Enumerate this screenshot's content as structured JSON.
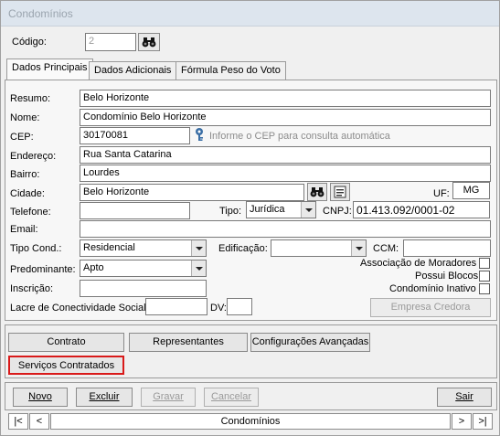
{
  "window": {
    "title": "Condomínios"
  },
  "header": {
    "codigo_label": "Código:",
    "codigo_value": "2"
  },
  "tabs": [
    {
      "label": "Dados Principais"
    },
    {
      "label": "Dados Adicionais"
    },
    {
      "label": "Fórmula Peso do Voto"
    }
  ],
  "form": {
    "resumo_label": "Resumo:",
    "resumo_value": "Belo Horizonte",
    "nome_label": "Nome:",
    "nome_value": "Condomínio Belo Horizonte",
    "cep_label": "CEP:",
    "cep_value": "30170081",
    "cep_hint": "Informe o CEP para consulta automática",
    "endereco_label": "Endereço:",
    "endereco_value": "Rua Santa Catarina",
    "bairro_label": "Bairro:",
    "bairro_value": "Lourdes",
    "cidade_label": "Cidade:",
    "cidade_value": "Belo Horizonte",
    "uf_label": "UF:",
    "uf_value": "MG",
    "telefone_label": "Telefone:",
    "telefone_value": "",
    "tipo_label": "Tipo:",
    "tipo_value": "Jurídica",
    "cnpj_label": "CNPJ:",
    "cnpj_value": "01.413.092/0001-02",
    "email_label": "Email:",
    "email_value": "",
    "tipo_cond_label": "Tipo Cond.:",
    "tipo_cond_value": "Residencial",
    "edificacao_label": "Edificação:",
    "edificacao_value": "",
    "ccm_label": "CCM:",
    "ccm_value": "",
    "predominante_label": "Predominante:",
    "predominante_value": "Apto",
    "inscricao_label": "Inscrição:",
    "inscricao_value": "",
    "lacre_label": "Lacre de Conectividade Social:",
    "lacre_value": "",
    "dv_label": "DV:",
    "dv_value": "",
    "assoc_label": "Associação de Moradores",
    "assoc_checked": false,
    "blocos_label": "Possui Blocos",
    "blocos_checked": false,
    "inativo_label": "Condomínio Inativo",
    "inativo_checked": false,
    "empresa_credora_label": "Empresa Credora"
  },
  "section_buttons": {
    "contrato": "Contrato",
    "representantes": "Representantes",
    "config": "Configurações Avançadas",
    "servicos": "Serviços Contratados"
  },
  "actions": {
    "novo": "Novo",
    "excluir": "Excluir",
    "gravar": "Gravar",
    "cancelar": "Cancelar",
    "sair": "Sair"
  },
  "navigator": {
    "first": "|<",
    "prev": "<",
    "label": "Condomínios",
    "next": ">",
    "last": ">|"
  },
  "colors": {
    "highlight_border": "#d91a1a",
    "title_text": "#9aa4ae"
  },
  "icons": {
    "search": "binoculars-icon",
    "lookup": "key-icon",
    "list": "list-icon"
  }
}
